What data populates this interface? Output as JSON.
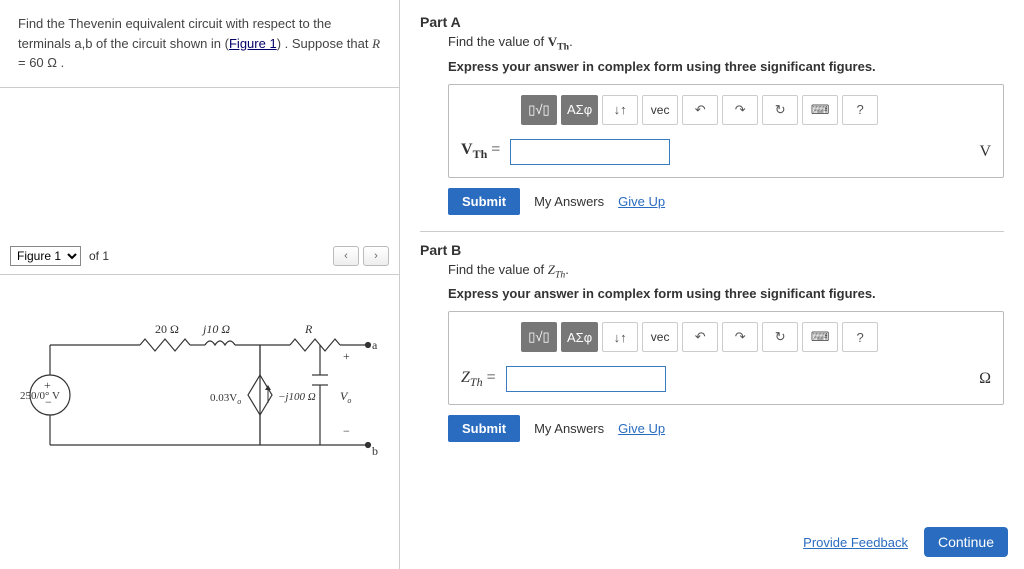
{
  "problem": {
    "text_before_link": "Find the Thevenin equivalent circuit with respect to the terminals a,b of the circuit shown in (",
    "link_text": "Figure 1",
    "text_after_link": ") . Suppose that ",
    "rvar": "R",
    "equals": " = 60 ",
    "ohm": "Ω",
    "period": " ."
  },
  "figure": {
    "label": "Figure 1",
    "of": "of 1",
    "nav_prev": "‹",
    "nav_next": "›"
  },
  "circuit": {
    "src_label": "250/0° V",
    "r1": "20 Ω",
    "l1": "j10 Ω",
    "dep_src": "0.03V",
    "dep_sub": "o",
    "r_label": "R",
    "c1": "−j100 Ω",
    "vo": "V",
    "vo_sub": "o",
    "term_a": "a",
    "term_b": "b",
    "plus": "+",
    "minus": "−"
  },
  "partA": {
    "title": "Part A",
    "find": "Find the value of ",
    "var_letter": "V",
    "var_sub": "Th",
    "period": ".",
    "express": "Express your answer in complex form using three significant figures.",
    "label_var": "V",
    "label_sub": "Th",
    "equals": " = ",
    "unit": "V",
    "submit": "Submit",
    "my_answers": "My Answers",
    "give_up": "Give Up"
  },
  "partB": {
    "title": "Part B",
    "find": "Find the value of ",
    "var_letter": "Z",
    "var_sub": "Th",
    "period": ".",
    "express": "Express your answer in complex form using three significant figures.",
    "label_var": "Z",
    "label_sub": "Th",
    "equals": " = ",
    "unit": "Ω",
    "submit": "Submit",
    "my_answers": "My Answers",
    "give_up": "Give Up"
  },
  "toolbar": {
    "templates": "▯√▯",
    "greek": "ΑΣφ",
    "subscript": "↓↑",
    "vec": "vec",
    "undo": "↶",
    "redo": "↷",
    "reset": "↻",
    "keyboard": "⌨",
    "help": "?"
  },
  "footer": {
    "feedback": "Provide Feedback",
    "continue": "Continue"
  }
}
